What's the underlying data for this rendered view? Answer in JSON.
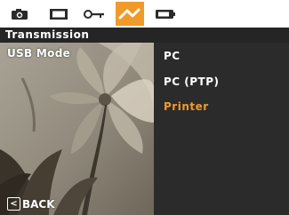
{
  "colors": {
    "accent": "#f09a2a",
    "title_bar": "#252525",
    "options_bg": "#2b2b2b",
    "text": "#ffffff"
  },
  "tabs": [
    {
      "icon": "camera-icon",
      "active": false
    },
    {
      "icon": "playback-icon",
      "active": false
    },
    {
      "icon": "key-icon",
      "active": false
    },
    {
      "icon": "wrench-icon",
      "active": true
    },
    {
      "icon": "battery-icon",
      "active": false
    }
  ],
  "title": "Transmission",
  "setting": {
    "label": "USB Mode"
  },
  "options": [
    {
      "label": "PC",
      "selected": false
    },
    {
      "label": "PC (PTP)",
      "selected": false
    },
    {
      "label": "Printer",
      "selected": true
    }
  ],
  "footer": {
    "back_key": "<",
    "back_label": "BACK"
  }
}
